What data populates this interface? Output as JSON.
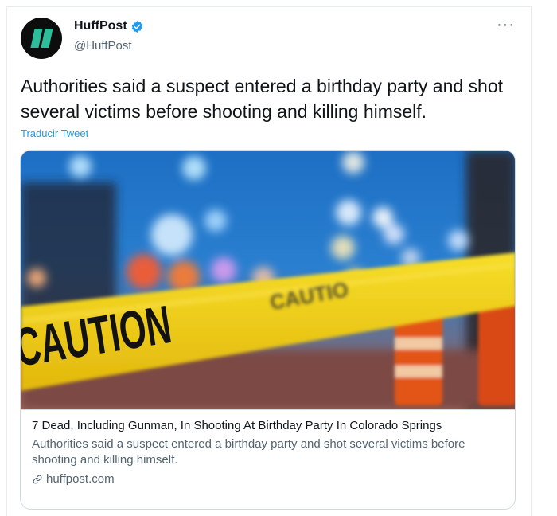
{
  "author": {
    "display_name": "HuffPost",
    "handle": "@HuffPost"
  },
  "more_label": "···",
  "tweet": {
    "text": "Authorities said a suspect entered a birthday party and shot several victims before shooting and killing himself.",
    "translate_label": "Traducir Tweet"
  },
  "card": {
    "image_text": "CAUTION",
    "image_text_2": "CAUTIO",
    "title": "7 Dead, Including Gunman, In Shooting At Birthday Party In Colorado Springs",
    "description": "Authorities said a suspect entered a birthday party and shot several victims before shooting and killing himself.",
    "domain": "huffpost.com"
  },
  "colors": {
    "link_blue": "#1d9bf0",
    "verified_blue": "#1d9bf0",
    "brand_green": "#2ebd9a",
    "caution_yellow": "#f2d21b"
  },
  "icons": {
    "verified": "verified-badge-icon",
    "more": "more-horizontal-icon",
    "link": "link-icon"
  }
}
